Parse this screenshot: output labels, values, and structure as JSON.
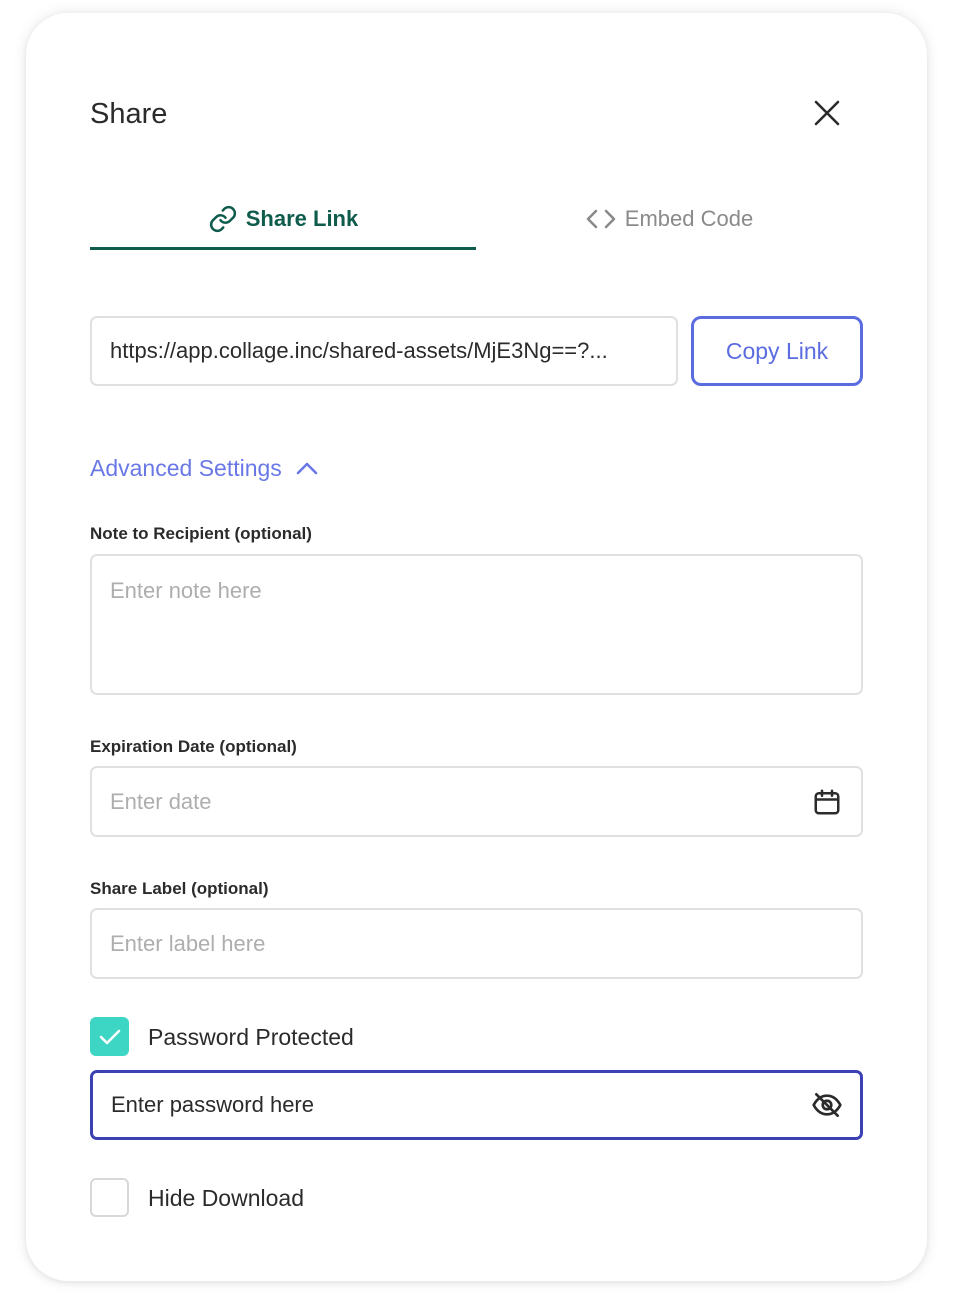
{
  "dialog": {
    "title": "Share",
    "close_icon": "close-icon"
  },
  "tabs": [
    {
      "label": "Share Link",
      "icon": "link-icon",
      "active": true
    },
    {
      "label": "Embed Code",
      "icon": "code-icon",
      "active": false
    }
  ],
  "share_link": {
    "url": "https://app.collage.inc/shared-assets/MjE3Ng==?...",
    "copy_label": "Copy Link"
  },
  "advanced": {
    "label": "Advanced Settings",
    "expanded": true,
    "icon": "chevron-up-icon"
  },
  "note": {
    "label": "Note to Recipient (optional)",
    "placeholder": "Enter note here"
  },
  "expiration": {
    "label": "Expiration Date (optional)",
    "placeholder": "Enter date",
    "icon": "calendar-icon"
  },
  "share_label": {
    "label": "Share Label (optional)",
    "placeholder": "Enter label here"
  },
  "password_protected": {
    "label": "Password Protected",
    "checked": true
  },
  "password": {
    "placeholder": "Enter password here",
    "icon": "eye-off-icon"
  },
  "hide_download": {
    "label": "Hide Download",
    "checked": false
  },
  "colors": {
    "accent_green": "#0f5c4c",
    "accent_blue": "#5b6ce0",
    "checkbox_teal": "#3dd6c4",
    "focus_border": "#3b41b2"
  }
}
